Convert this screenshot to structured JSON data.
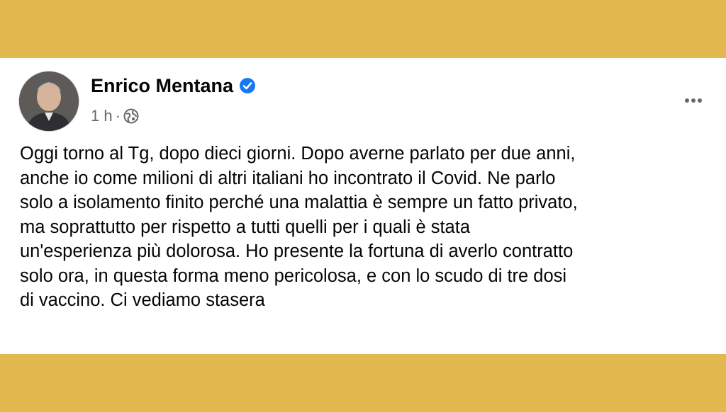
{
  "post": {
    "author": "Enrico Mentana",
    "time": "1 h",
    "separator": "·",
    "icons": {
      "avatar": "profile-photo",
      "verified": "verified-badge-icon",
      "audience": "globe-icon",
      "more": "more-options-icon"
    },
    "colors": {
      "verified": "#1877f2",
      "text": "#050505",
      "meta": "#65676b",
      "frame": "#e3b84f"
    },
    "lines": [
      "Oggi torno al Tg, dopo dieci giorni. Dopo averne parlato per due anni,",
      "anche io come milioni di altri italiani ho incontrato il Covid. Ne parlo",
      "solo a isolamento finito perché una malattia è sempre un fatto privato,",
      "ma soprattutto per rispetto a tutti quelli per i quali è stata",
      "un'esperienza più dolorosa. Ho presente la fortuna di averlo contratto",
      "solo ora, in questa forma meno pericolosa, e con lo scudo di tre dosi",
      "di vaccino. Ci vediamo stasera"
    ]
  }
}
